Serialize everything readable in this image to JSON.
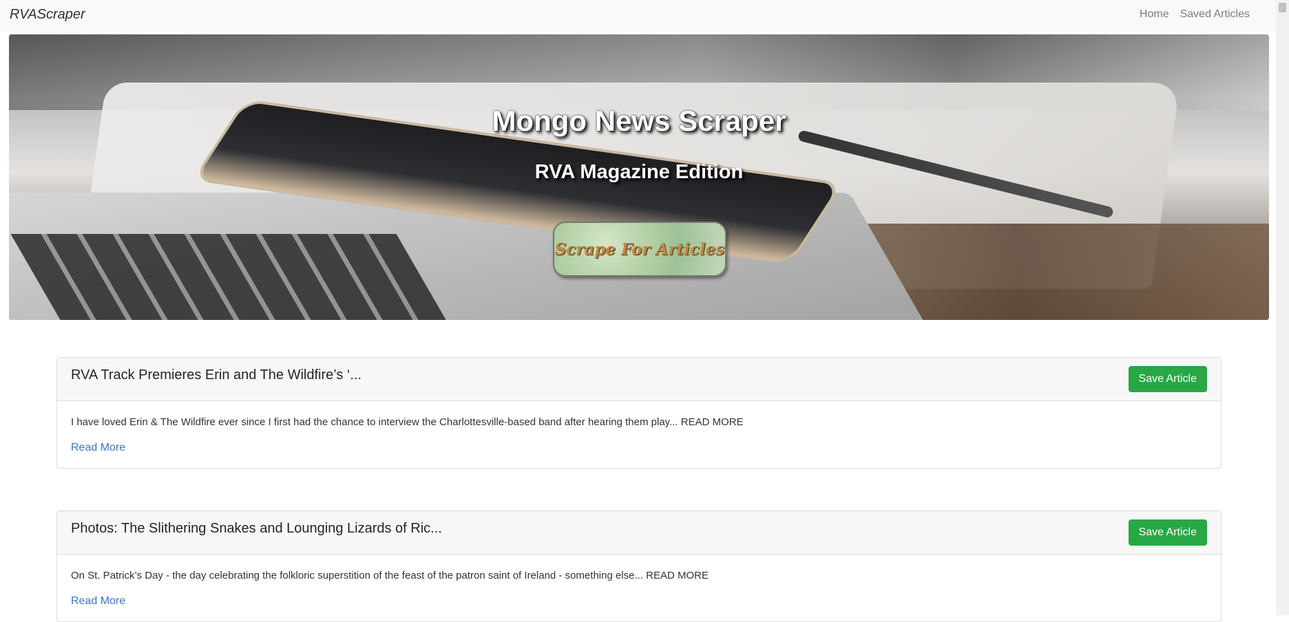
{
  "navbar": {
    "brand": "RVAScraper",
    "links": [
      "Home",
      "Saved Articles"
    ]
  },
  "hero": {
    "title": "Mongo News Scraper",
    "subtitle": "RVA Magazine Edition",
    "scrape_button": "Scrape For Articles"
  },
  "articles": [
    {
      "title": "RVA Track Premieres Erin and The Wildfire’s ‘...",
      "summary": "I have loved Erin & The Wildfire ever since I first had the chance to interview the Charlottesville-based band after hearing them play... READ MORE",
      "save_label": "Save Article",
      "link_label": "Read More"
    },
    {
      "title": "Photos: The Slithering Snakes and Lounging Lizards of Ric...",
      "summary": "On St. Patrick’s Day - the day celebrating the folkloric superstition of the feast of the patron saint of Ireland - something else... READ MORE",
      "save_label": "Save Article",
      "link_label": "Read More"
    }
  ],
  "colors": {
    "save_button": "#28a745",
    "link": "#3a77c9",
    "navbar_bg": "#f8f9fa"
  }
}
